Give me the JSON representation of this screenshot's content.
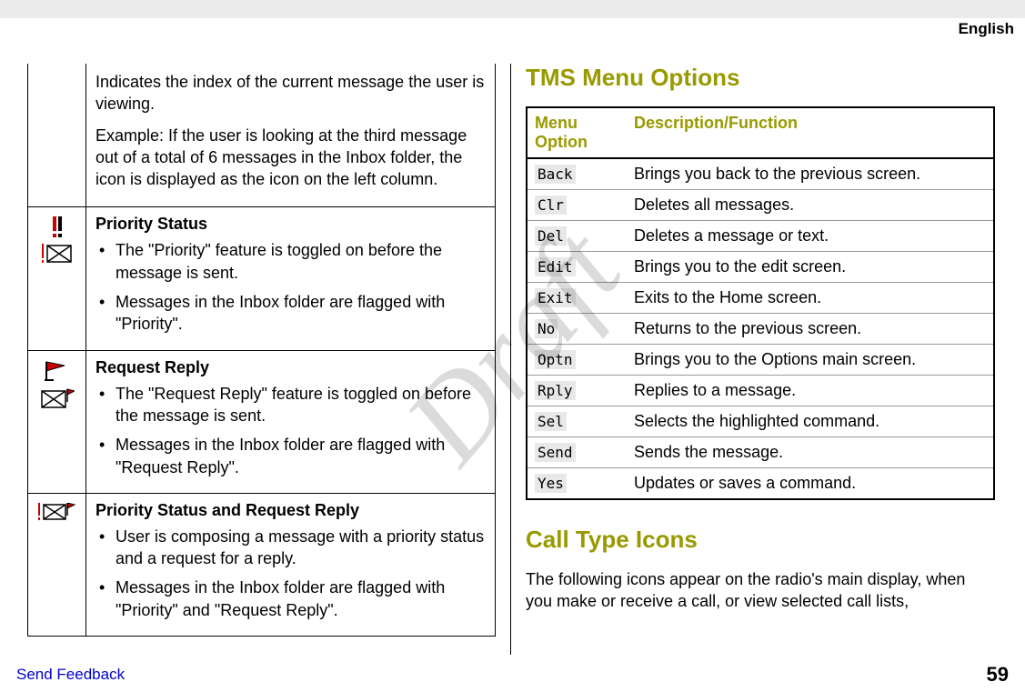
{
  "header": {
    "language": "English"
  },
  "watermark": "Draft",
  "left": {
    "intro": {
      "line1": "Indicates the index of the current message the user is viewing.",
      "line2": "Example: If the user is looking at the third message out of a total of 6 messages in the Inbox folder, the icon is displayed as the icon on the left column."
    },
    "rows": [
      {
        "title": "Priority Status",
        "bullets": [
          "The \"Priority\" feature is toggled on before the message is sent.",
          "Messages in the Inbox folder are flagged with \"Priority\"."
        ]
      },
      {
        "title": "Request Reply",
        "bullets": [
          "The \"Request Reply\" feature is toggled on before the message is sent.",
          "Messages in the Inbox folder are flagged with \"Request Reply\"."
        ]
      },
      {
        "title": "Priority Status and Request Reply",
        "bullets": [
          "User is composing a message with a priority status and a request for a reply.",
          "Messages in the Inbox folder are flagged with \"Priority\" and \"Request Reply\"."
        ]
      }
    ]
  },
  "right": {
    "heading_tms": "TMS Menu Options",
    "table_headers": {
      "opt": "Menu Option",
      "desc": "Description/Function"
    },
    "menu": [
      {
        "opt": "Back",
        "desc": "Brings you back to the previous screen."
      },
      {
        "opt": "Clr",
        "desc": "Deletes all messages."
      },
      {
        "opt": "Del",
        "desc": "Deletes a message or text."
      },
      {
        "opt": "Edit",
        "desc": "Brings you to the edit screen."
      },
      {
        "opt": "Exit",
        "desc": "Exits to the Home screen."
      },
      {
        "opt": "No",
        "desc": "Returns to the previous screen."
      },
      {
        "opt": "Optn",
        "desc": "Brings you to the Options main screen."
      },
      {
        "opt": "Rply",
        "desc": "Replies to a message."
      },
      {
        "opt": "Sel",
        "desc": "Selects the highlighted command."
      },
      {
        "opt": "Send",
        "desc": "Sends the message."
      },
      {
        "opt": "Yes",
        "desc": "Updates or saves a command."
      }
    ],
    "heading_call": "Call Type Icons",
    "call_intro": "The following icons appear on the radio's main display, when you make or receive a call, or view selected call lists,"
  },
  "footer": {
    "send": "Send Feedback",
    "page": "59"
  }
}
